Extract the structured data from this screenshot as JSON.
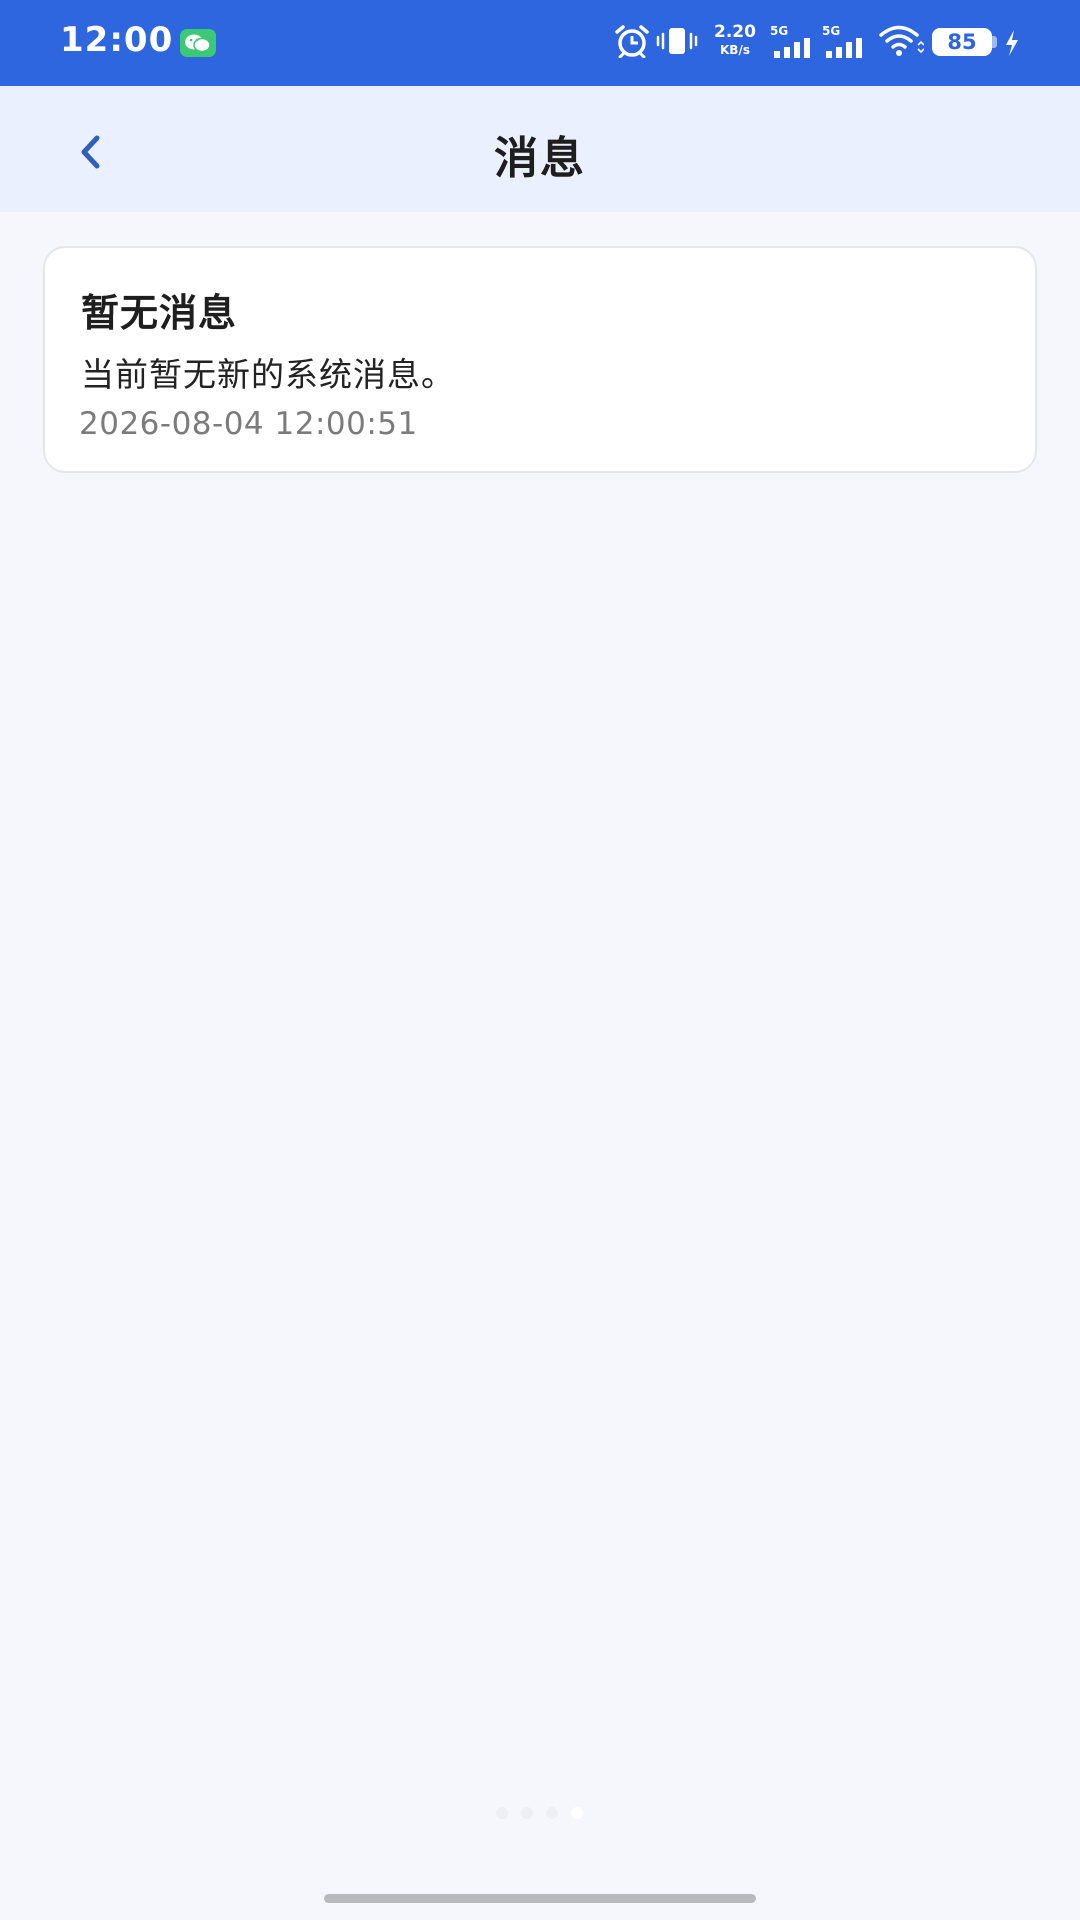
{
  "status_bar": {
    "time": "12:00",
    "net_speed_value": "2.20",
    "net_speed_unit": "KB/s",
    "signal1_label": "5G",
    "signal2_label": "5G",
    "battery_level": "85"
  },
  "header": {
    "title": "消息"
  },
  "message": {
    "title": "暂无消息",
    "body": "当前暂无新的系统消息。",
    "timestamp": "2026-08-04 12:00:51"
  },
  "pager": {
    "count": 4,
    "active_index": 3
  },
  "colors": {
    "status_bar_bg": "#2e66e0",
    "header_bg": "#eaf0fd",
    "page_bg": "#f5f7fc",
    "back_icon": "#2f5fba",
    "wechat_badge": "#3cc977"
  },
  "icons": {
    "back": "chevron-left-icon",
    "notification": "wechat-icon",
    "alarm": "alarm-icon",
    "vibrate": "vibrate-icon",
    "wifi": "wifi-icon",
    "charging": "bolt-icon"
  }
}
